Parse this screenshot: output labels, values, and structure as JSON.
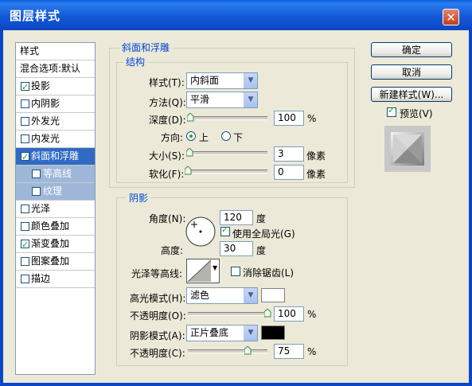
{
  "window": {
    "title": "图层样式",
    "close_symbol": "✕"
  },
  "styles_list": {
    "header": "样式",
    "blending": "混合选项:默认",
    "items": [
      {
        "label": "投影",
        "checked": true
      },
      {
        "label": "内阴影",
        "checked": false
      },
      {
        "label": "外发光",
        "checked": false
      },
      {
        "label": "内发光",
        "checked": false
      },
      {
        "label": "斜面和浮雕",
        "checked": true,
        "selected": true
      },
      {
        "label": "等高线",
        "checked": false,
        "sub": true
      },
      {
        "label": "纹理",
        "checked": false,
        "sub": true
      },
      {
        "label": "光泽",
        "checked": false
      },
      {
        "label": "颜色叠加",
        "checked": false
      },
      {
        "label": "渐变叠加",
        "checked": true
      },
      {
        "label": "图案叠加",
        "checked": false
      },
      {
        "label": "描边",
        "checked": false
      }
    ]
  },
  "buttons": {
    "ok": "确定",
    "cancel": "取消",
    "new_style": "新建样式(W)...",
    "preview_label": "预览(V)",
    "preview_checked": true
  },
  "bevel": {
    "section_title": "斜面和浮雕",
    "structure_title": "结构",
    "style_label": "样式(T):",
    "style_value": "内斜面",
    "technique_label": "方法(Q):",
    "technique_value": "平滑",
    "depth_label": "深度(D):",
    "depth_value": "100",
    "depth_unit": "%",
    "depth_level": 0.03,
    "direction_label": "方向:",
    "direction_up": "上",
    "direction_down": "下",
    "direction_selected": "上",
    "size_label": "大小(S):",
    "size_value": "3",
    "size_unit": "像素",
    "size_level": 0.02,
    "soften_label": "软化(F):",
    "soften_value": "0",
    "soften_unit": "像素",
    "soften_level": 0.0
  },
  "shading": {
    "title": "阴影",
    "angle_label": "角度(N):",
    "angle_value": "120",
    "angle_unit": "度",
    "global_light_label": "使用全局光(G)",
    "global_light_checked": true,
    "altitude_label": "高度:",
    "altitude_value": "30",
    "altitude_unit": "度",
    "gloss_contour_label": "光泽等高线:",
    "antialias_label": "消除锯齿(L)",
    "antialias_checked": false,
    "highlight_mode_label": "高光模式(H):",
    "highlight_mode_value": "滤色",
    "highlight_color": "#ffffff",
    "highlight_opacity_label": "不透明度(O):",
    "highlight_opacity_value": "100",
    "highlight_opacity_unit": "%",
    "highlight_opacity_level": 1.0,
    "shadow_mode_label": "阴影模式(A):",
    "shadow_mode_value": "正片叠底",
    "shadow_color": "#000000",
    "shadow_opacity_label": "不透明度(C):",
    "shadow_opacity_value": "75",
    "shadow_opacity_unit": "%",
    "shadow_opacity_level": 0.75
  },
  "colors": {
    "title_bar": "#0b46c4",
    "selection": "#316ac5",
    "group_title": "#0046d5",
    "check": "#21a121"
  }
}
